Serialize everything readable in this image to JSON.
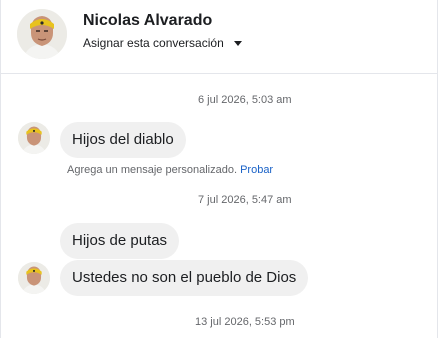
{
  "header": {
    "contact_name": "Nicolas Alvarado",
    "assign_label": "Asignar esta conversación",
    "avatar_icon": "profile-photo-avatar"
  },
  "thread": {
    "timestamps": [
      "6 jul 2026, 5:03 am",
      "7 jul 2026, 5:47 am",
      "13 jul 2026, 5:53 pm"
    ],
    "messages": [
      {
        "text": "Hijos del diablo"
      },
      {
        "text": "Hijos de putas"
      },
      {
        "text": "Ustedes no son el pueblo de Dios"
      }
    ],
    "hint": {
      "text": "Agrega un mensaje personalizado.",
      "action": "Probar"
    }
  },
  "colors": {
    "bubble": "#f0f0f0",
    "link": "#1a62c7",
    "muted_text": "#65676b",
    "avatar_headband": "#e8c21e"
  }
}
